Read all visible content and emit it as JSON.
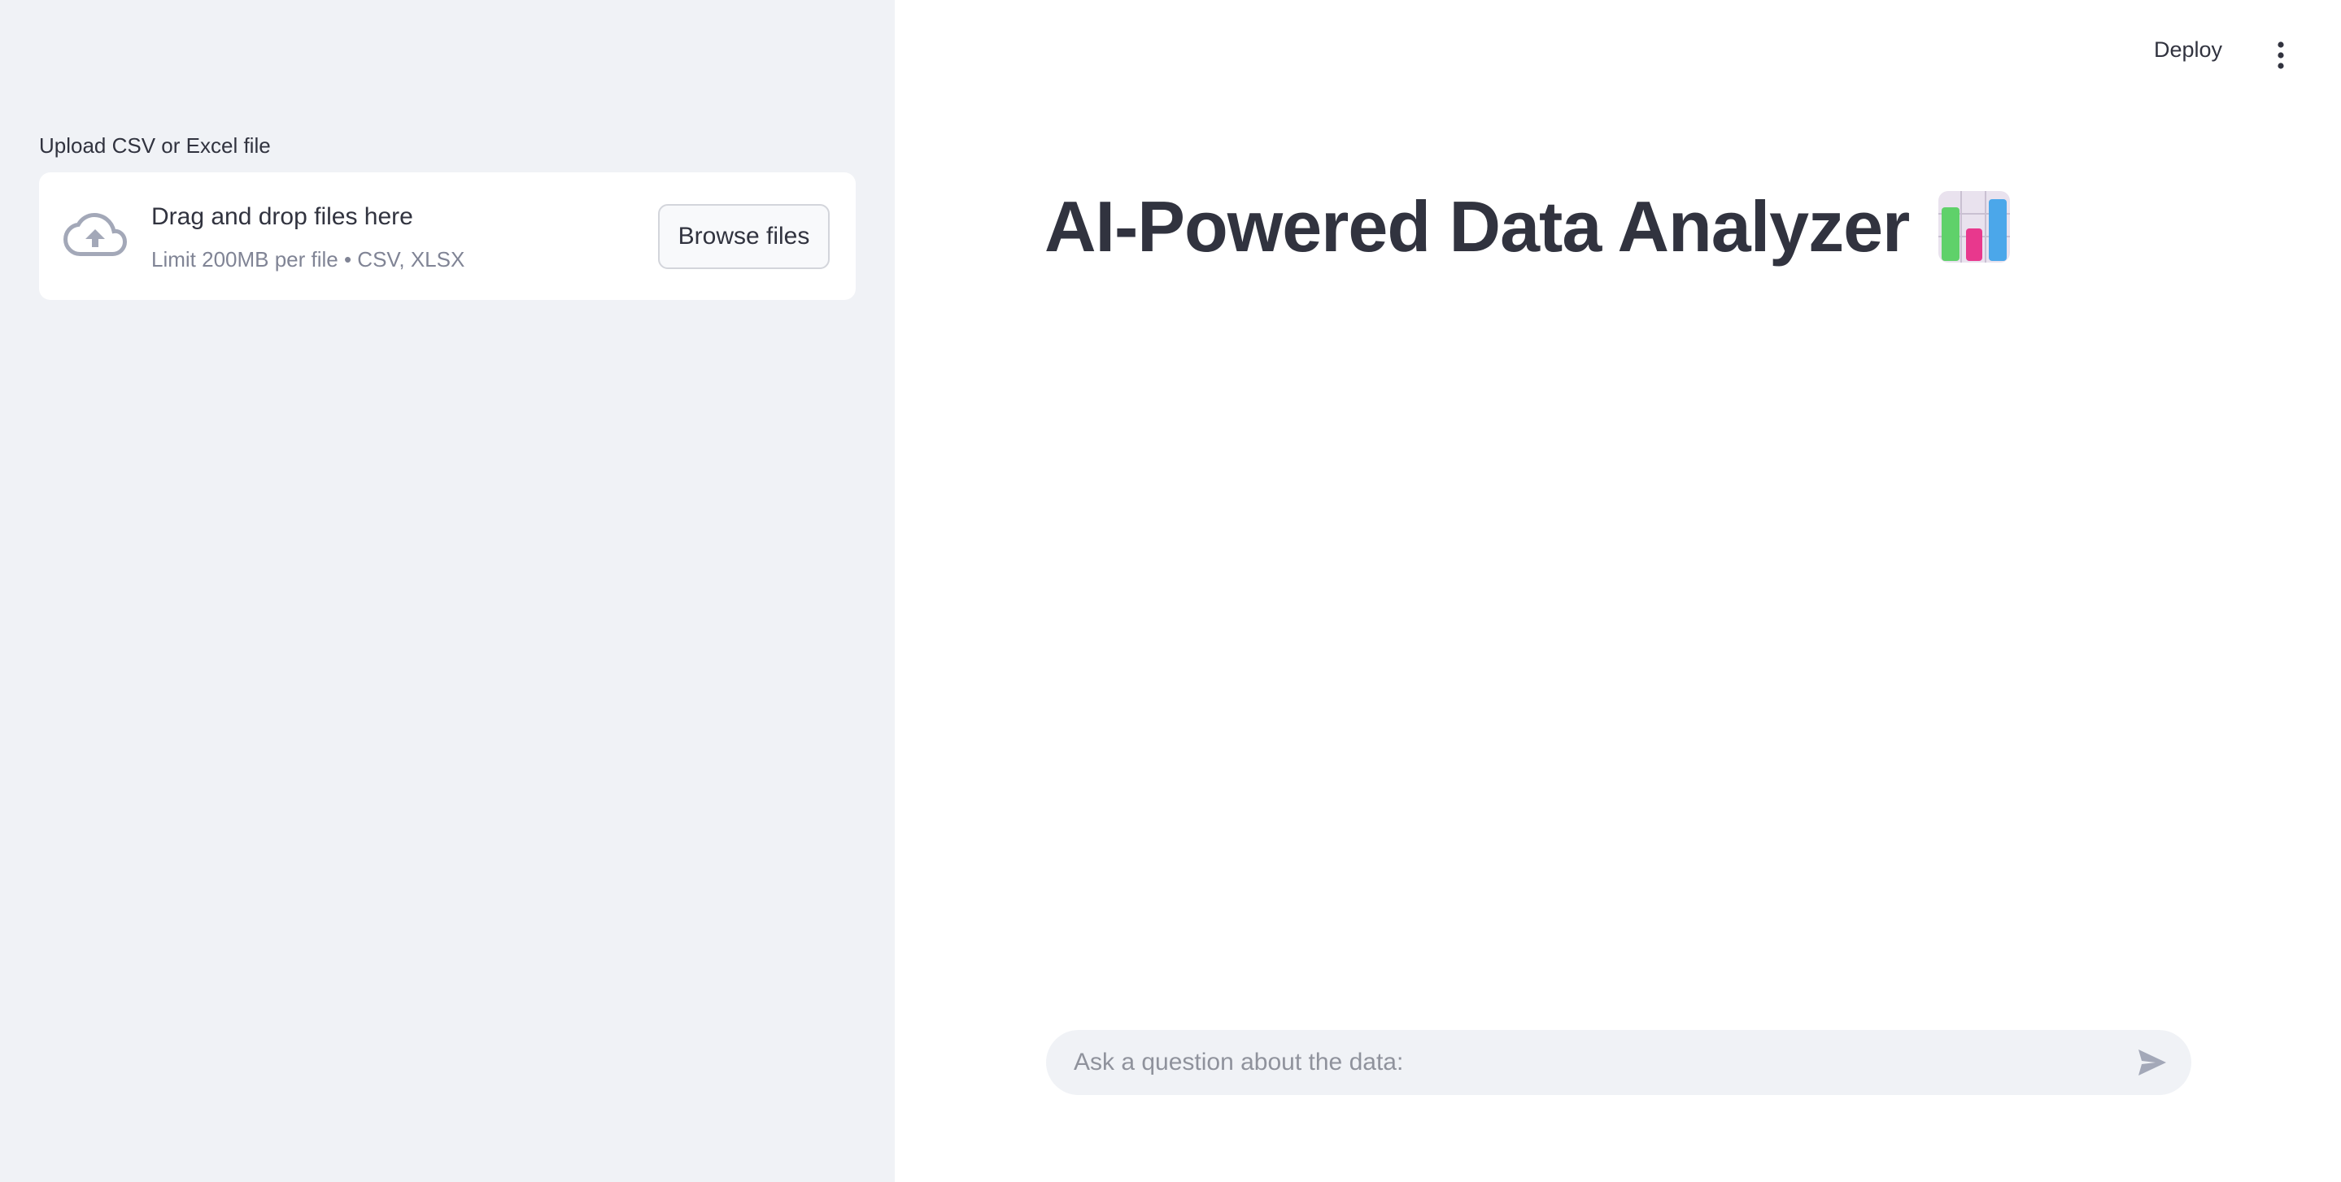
{
  "sidebar": {
    "uploader": {
      "label": "Upload CSV or Excel file",
      "drop_text": "Drag and drop files here",
      "limit_text": "Limit 200MB per file • CSV, XLSX",
      "browse_label": "Browse files",
      "icon": "cloud-upload-icon"
    }
  },
  "header": {
    "deploy_label": "Deploy",
    "menu_icon": "vertical-dots-icon"
  },
  "main": {
    "title": "AI-Powered Data Analyzer",
    "title_emoji": "bar-chart-emoji",
    "chat": {
      "placeholder": "Ask a question about the data:",
      "value": "",
      "send_icon": "send-icon"
    }
  },
  "colors": {
    "sidebar_bg": "#f0f2f6",
    "text": "#31333f",
    "muted_text": "#808495",
    "icon_gray": "#a3a8b8",
    "input_bg": "#f0f2f6"
  }
}
